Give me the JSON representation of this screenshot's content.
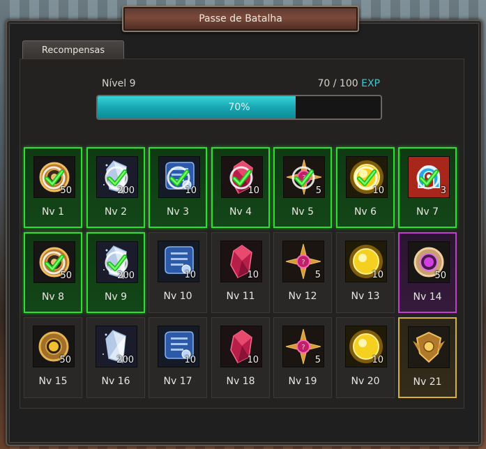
{
  "window": {
    "title": "Passe de Batalha",
    "tab_label": "Recompensas"
  },
  "progress": {
    "level_label": "Nível 9",
    "exp_current": "70 / 100",
    "exp_suffix": "EXP",
    "percent_text": "70%",
    "fraction": 0.7
  },
  "rewards": [
    {
      "level": "Nv 1",
      "qty": "50",
      "icon": "bronze-ring-icon",
      "state": "claimed"
    },
    {
      "level": "Nv 2",
      "qty": "200",
      "icon": "white-crystal-icon",
      "state": "claimed"
    },
    {
      "level": "Nv 3",
      "qty": "10",
      "icon": "blue-scroll-icon",
      "state": "claimed"
    },
    {
      "level": "Nv 4",
      "qty": "10",
      "icon": "red-gem-icon",
      "state": "claimed"
    },
    {
      "level": "Nv 5",
      "qty": "5",
      "icon": "compass-star-icon",
      "state": "claimed"
    },
    {
      "level": "Nv 6",
      "qty": "10",
      "icon": "gold-orb-icon",
      "state": "claimed"
    },
    {
      "level": "Nv 7",
      "qty": "3",
      "icon": "blue-horseshoe-icon",
      "state": "claimed"
    },
    {
      "level": "Nv 8",
      "qty": "50",
      "icon": "bronze-ring-icon",
      "state": "claimed"
    },
    {
      "level": "Nv 9",
      "qty": "200",
      "icon": "white-crystal-icon",
      "state": "claimed"
    },
    {
      "level": "Nv 10",
      "qty": "10",
      "icon": "blue-scroll-icon",
      "state": "locked"
    },
    {
      "level": "Nv 11",
      "qty": "10",
      "icon": "red-gem-icon",
      "state": "locked"
    },
    {
      "level": "Nv 12",
      "qty": "5",
      "icon": "compass-star-icon",
      "state": "locked"
    },
    {
      "level": "Nv 13",
      "qty": "10",
      "icon": "gold-orb-icon",
      "state": "locked"
    },
    {
      "level": "Nv 14",
      "qty": "50",
      "icon": "purple-ring-icon",
      "state": "special"
    },
    {
      "level": "Nv 15",
      "qty": "50",
      "icon": "gold-ring-icon",
      "state": "locked"
    },
    {
      "level": "Nv 16",
      "qty": "200",
      "icon": "white-crystal-icon",
      "state": "locked"
    },
    {
      "level": "Nv 17",
      "qty": "10",
      "icon": "blue-scroll-icon",
      "state": "locked"
    },
    {
      "level": "Nv 18",
      "qty": "10",
      "icon": "red-gem-icon",
      "state": "locked"
    },
    {
      "level": "Nv 19",
      "qty": "5",
      "icon": "compass-star-icon",
      "state": "locked"
    },
    {
      "level": "Nv 20",
      "qty": "10",
      "icon": "gold-orb-icon",
      "state": "locked"
    },
    {
      "level": "Nv 21",
      "qty": "",
      "icon": "golden-emblem-icon",
      "state": "gold"
    }
  ],
  "colors": {
    "claimed_border": "#2ddf2f",
    "special_border": "#c23cd2",
    "gold_border": "#d6b23a",
    "exp_accent": "#3fc9d0",
    "bar_fill": "#17a7b2"
  }
}
